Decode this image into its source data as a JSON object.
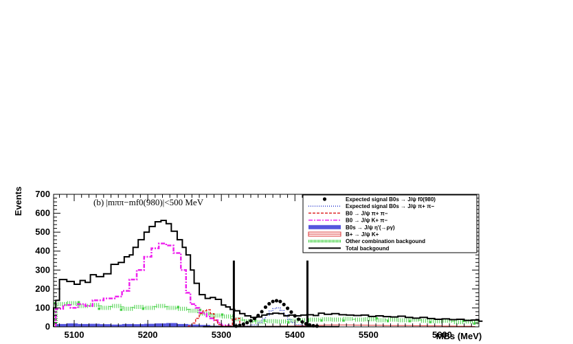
{
  "chart_data": {
    "type": "histogram",
    "annotation": "(b) |mππ−mf0(980)|<500 MeV",
    "xlabel": "MBs (MeV)",
    "ylabel": "Events",
    "xlim": [
      5072,
      5650
    ],
    "ylim": [
      0,
      700
    ],
    "xticks": [
      5100,
      5200,
      5300,
      5400,
      5500,
      5600
    ],
    "yticks": [
      0,
      100,
      200,
      300,
      400,
      500,
      600,
      700
    ],
    "legend_position": "top-right",
    "bin_start": 5075,
    "bin_width": 5,
    "signal_window": [
      5317,
      5417
    ],
    "series": [
      {
        "name": "Expected signal B0s → J/ψ f0(980)",
        "style": "markers",
        "color": "#000000",
        "points": [
          [
            5320,
            4
          ],
          [
            5325,
            8
          ],
          [
            5330,
            14
          ],
          [
            5335,
            22
          ],
          [
            5340,
            32
          ],
          [
            5345,
            44
          ],
          [
            5350,
            60
          ],
          [
            5355,
            80
          ],
          [
            5360,
            104
          ],
          [
            5365,
            122
          ],
          [
            5370,
            134
          ],
          [
            5375,
            138
          ],
          [
            5380,
            134
          ],
          [
            5385,
            118
          ],
          [
            5390,
            98
          ],
          [
            5395,
            78
          ],
          [
            5400,
            58
          ],
          [
            5405,
            40
          ],
          [
            5410,
            26
          ],
          [
            5415,
            16
          ],
          [
            5420,
            10
          ],
          [
            5425,
            6
          ],
          [
            5430,
            4
          ]
        ]
      },
      {
        "name": "Expected signal B0s → J/ψ π+ π−",
        "style": "dotted",
        "color": "#2233cc",
        "points": [
          [
            5330,
            4
          ],
          [
            5340,
            10
          ],
          [
            5350,
            24
          ],
          [
            5355,
            42
          ],
          [
            5360,
            62
          ],
          [
            5365,
            84
          ],
          [
            5370,
            96
          ],
          [
            5375,
            100
          ],
          [
            5380,
            86
          ],
          [
            5385,
            62
          ],
          [
            5390,
            40
          ],
          [
            5395,
            22
          ],
          [
            5400,
            12
          ],
          [
            5410,
            4
          ]
        ]
      },
      {
        "name": "B0 → J/ψ π+ π−",
        "style": "dashed",
        "color": "#dd2222",
        "points": [
          [
            5255,
            4
          ],
          [
            5260,
            20
          ],
          [
            5265,
            45
          ],
          [
            5270,
            70
          ],
          [
            5275,
            85
          ],
          [
            5280,
            90
          ],
          [
            5285,
            70
          ],
          [
            5290,
            35
          ],
          [
            5295,
            12
          ],
          [
            5300,
            4
          ],
          [
            5310,
            4
          ],
          [
            5315,
            40
          ],
          [
            5320,
            45
          ],
          [
            5325,
            4
          ],
          [
            5335,
            2
          ]
        ]
      },
      {
        "name": "B0 → J/ψ K+ π−",
        "style": "dashdot",
        "color": "#ee22ee",
        "points": [
          [
            5075,
            95
          ],
          [
            5085,
            115
          ],
          [
            5095,
            100
          ],
          [
            5105,
            120
          ],
          [
            5115,
            110
          ],
          [
            5125,
            140
          ],
          [
            5140,
            150
          ],
          [
            5155,
            160
          ],
          [
            5165,
            190
          ],
          [
            5175,
            250
          ],
          [
            5185,
            300
          ],
          [
            5195,
            370
          ],
          [
            5205,
            415
          ],
          [
            5215,
            440
          ],
          [
            5225,
            430
          ],
          [
            5235,
            390
          ],
          [
            5245,
            300
          ],
          [
            5252,
            180
          ],
          [
            5258,
            120
          ],
          [
            5265,
            100
          ],
          [
            5270,
            75
          ],
          [
            5275,
            70
          ],
          [
            5280,
            55
          ],
          [
            5285,
            45
          ],
          [
            5290,
            35
          ],
          [
            5295,
            20
          ],
          [
            5300,
            8
          ],
          [
            5310,
            4
          ]
        ]
      },
      {
        "name": "B0s → J/ψ η'(→ργ)",
        "style": "filled",
        "color": "#5555dd",
        "points": [
          [
            5075,
            15
          ],
          [
            5090,
            18
          ],
          [
            5105,
            15
          ],
          [
            5120,
            16
          ],
          [
            5135,
            14
          ],
          [
            5150,
            12
          ],
          [
            5165,
            15
          ],
          [
            5180,
            14
          ],
          [
            5195,
            16
          ],
          [
            5210,
            18
          ],
          [
            5225,
            20
          ],
          [
            5240,
            15
          ],
          [
            5255,
            12
          ],
          [
            5270,
            10
          ],
          [
            5285,
            6
          ],
          [
            5300,
            4
          ],
          [
            5320,
            2
          ]
        ]
      },
      {
        "name": "B+ → J/ψ K+",
        "style": "hatched",
        "color": "#dd3333",
        "points": [
          [
            5340,
            2
          ],
          [
            5360,
            3
          ],
          [
            5380,
            4
          ],
          [
            5400,
            6
          ],
          [
            5420,
            8
          ],
          [
            5440,
            10
          ],
          [
            5460,
            10
          ],
          [
            5480,
            9
          ],
          [
            5500,
            8
          ],
          [
            5520,
            7
          ],
          [
            5540,
            7
          ],
          [
            5560,
            6
          ],
          [
            5580,
            5
          ],
          [
            5600,
            4
          ],
          [
            5620,
            3
          ],
          [
            5640,
            2
          ]
        ]
      },
      {
        "name": "Other combination backgound",
        "style": "dotted-band",
        "color": "#33cc33",
        "points": [
          [
            5075,
            120
          ],
          [
            5090,
            125
          ],
          [
            5105,
            110
          ],
          [
            5120,
            115
          ],
          [
            5135,
            100
          ],
          [
            5150,
            110
          ],
          [
            5165,
            95
          ],
          [
            5180,
            105
          ],
          [
            5195,
            100
          ],
          [
            5210,
            110
          ],
          [
            5225,
            100
          ],
          [
            5240,
            95
          ],
          [
            5255,
            85
          ],
          [
            5270,
            70
          ],
          [
            5285,
            60
          ],
          [
            5300,
            55
          ],
          [
            5315,
            40
          ],
          [
            5330,
            30
          ],
          [
            5345,
            25
          ],
          [
            5360,
            30
          ],
          [
            5375,
            28
          ],
          [
            5390,
            32
          ],
          [
            5405,
            35
          ],
          [
            5420,
            38
          ],
          [
            5435,
            40
          ],
          [
            5450,
            38
          ],
          [
            5465,
            42
          ],
          [
            5480,
            38
          ],
          [
            5495,
            40
          ],
          [
            5510,
            35
          ],
          [
            5525,
            38
          ],
          [
            5540,
            35
          ],
          [
            5555,
            38
          ],
          [
            5570,
            32
          ],
          [
            5585,
            30
          ],
          [
            5600,
            32
          ],
          [
            5615,
            25
          ],
          [
            5630,
            28
          ],
          [
            5645,
            22
          ]
        ]
      },
      {
        "name": "Total backgound",
        "style": "solid-step",
        "color": "#000000",
        "points": [
          [
            5072,
            100
          ],
          [
            5075,
            140
          ],
          [
            5080,
            250
          ],
          [
            5090,
            240
          ],
          [
            5100,
            225
          ],
          [
            5108,
            245
          ],
          [
            5115,
            235
          ],
          [
            5122,
            275
          ],
          [
            5130,
            265
          ],
          [
            5140,
            280
          ],
          [
            5150,
            330
          ],
          [
            5160,
            340
          ],
          [
            5168,
            370
          ],
          [
            5175,
            380
          ],
          [
            5180,
            420
          ],
          [
            5187,
            460
          ],
          [
            5195,
            500
          ],
          [
            5202,
            530
          ],
          [
            5210,
            555
          ],
          [
            5218,
            562
          ],
          [
            5225,
            545
          ],
          [
            5232,
            505
          ],
          [
            5240,
            460
          ],
          [
            5247,
            420
          ],
          [
            5252,
            380
          ],
          [
            5258,
            300
          ],
          [
            5263,
            230
          ],
          [
            5270,
            170
          ],
          [
            5278,
            150
          ],
          [
            5285,
            155
          ],
          [
            5292,
            145
          ],
          [
            5300,
            115
          ],
          [
            5306,
            105
          ],
          [
            5312,
            92
          ],
          [
            5318,
            85
          ],
          [
            5325,
            70
          ],
          [
            5332,
            58
          ],
          [
            5340,
            50
          ],
          [
            5348,
            52
          ],
          [
            5355,
            62
          ],
          [
            5362,
            68
          ],
          [
            5370,
            72
          ],
          [
            5378,
            70
          ],
          [
            5385,
            58
          ],
          [
            5392,
            62
          ],
          [
            5400,
            58
          ],
          [
            5408,
            62
          ],
          [
            5416,
            64
          ],
          [
            5425,
            60
          ],
          [
            5432,
            72
          ],
          [
            5440,
            66
          ],
          [
            5450,
            70
          ],
          [
            5460,
            64
          ],
          [
            5470,
            62
          ],
          [
            5480,
            60
          ],
          [
            5490,
            62
          ],
          [
            5500,
            55
          ],
          [
            5510,
            58
          ],
          [
            5520,
            54
          ],
          [
            5530,
            52
          ],
          [
            5540,
            56
          ],
          [
            5550,
            50
          ],
          [
            5560,
            46
          ],
          [
            5570,
            50
          ],
          [
            5580,
            44
          ],
          [
            5590,
            40
          ],
          [
            5600,
            42
          ],
          [
            5610,
            38
          ],
          [
            5620,
            40
          ],
          [
            5630,
            34
          ],
          [
            5640,
            36
          ],
          [
            5650,
            30
          ]
        ]
      }
    ]
  }
}
